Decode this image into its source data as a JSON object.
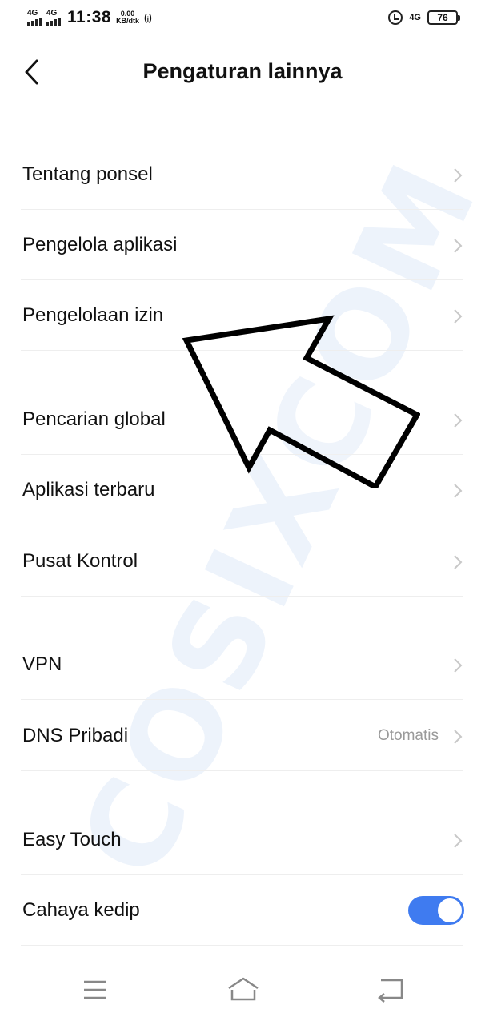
{
  "status_bar": {
    "sim1_network": "4G",
    "sim2_network": "4G",
    "time": "11:38",
    "speed_value": "0.00",
    "speed_unit": "KB/dtk",
    "hotspot": "(ᵢ)",
    "data_network": "4G",
    "battery": "76"
  },
  "header": {
    "title": "Pengaturan lainnya",
    "back_icon": "chevron-left-icon"
  },
  "watermark": "COSIXCOM",
  "menu": {
    "items": [
      {
        "label": "Tentang ponsel"
      },
      {
        "label": "Pengelola aplikasi"
      },
      {
        "label": "Pengelolaan izin"
      },
      {
        "label": "Pencarian global"
      },
      {
        "label": "Aplikasi terbaru"
      },
      {
        "label": "Pusat Kontrol"
      },
      {
        "label": "VPN"
      },
      {
        "label": "DNS Pribadi",
        "value": "Otomatis"
      },
      {
        "label": "Easy Touch"
      },
      {
        "label": "Cahaya kedip",
        "toggle": true
      }
    ]
  },
  "colors": {
    "toggle_on": "#3f7bf0",
    "chevron": "#c8c8c8",
    "watermark": "#edf3fb"
  },
  "nav": {
    "icons": [
      "menu-icon",
      "home-icon",
      "back-icon"
    ]
  }
}
